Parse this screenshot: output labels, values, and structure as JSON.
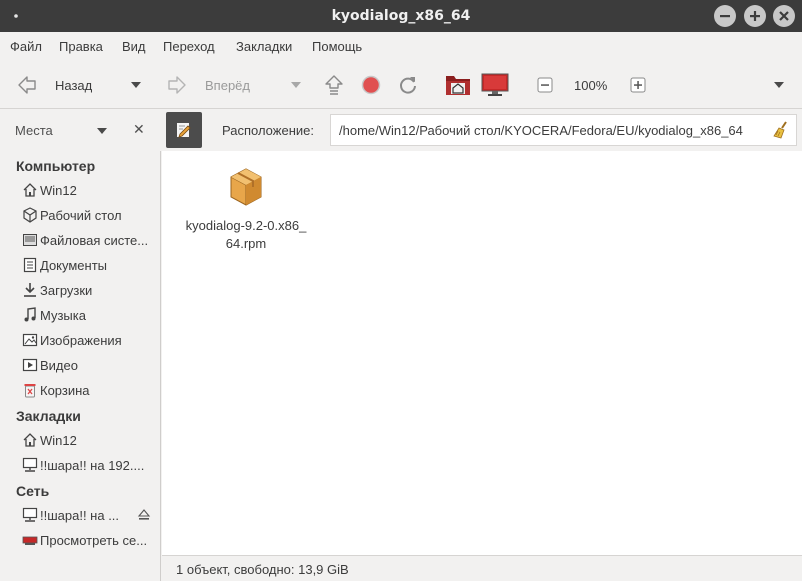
{
  "window": {
    "title": "kyodialog_x86_64"
  },
  "menubar": {
    "items": [
      "Файл",
      "Правка",
      "Вид",
      "Переход",
      "Закладки",
      "Помощь"
    ]
  },
  "toolbar": {
    "back_label": "Назад",
    "forward_label": "Вперёд",
    "zoom_level": "100%"
  },
  "location": {
    "places_label": "Места",
    "label": "Расположение:",
    "path": "/home/Win12/Рабочий стол/KYOCERA/Fedora/EU/kyodialog_x86_64"
  },
  "sidebar": {
    "sections": [
      {
        "title": "Компьютер",
        "items": [
          {
            "label": "Win12",
            "icon": "home-icon"
          },
          {
            "label": "Рабочий стол",
            "icon": "desktop-icon"
          },
          {
            "label": "Файловая систе...",
            "icon": "filesystem-icon"
          },
          {
            "label": "Документы",
            "icon": "documents-icon"
          },
          {
            "label": "Загрузки",
            "icon": "downloads-icon"
          },
          {
            "label": "Музыка",
            "icon": "music-icon"
          },
          {
            "label": "Изображения",
            "icon": "pictures-icon"
          },
          {
            "label": "Видео",
            "icon": "videos-icon"
          },
          {
            "label": "Корзина",
            "icon": "trash-icon"
          }
        ]
      },
      {
        "title": "Закладки",
        "items": [
          {
            "label": "Win12",
            "icon": "home-icon"
          },
          {
            "label": "!!шара!! на 192....",
            "icon": "network-share-icon"
          }
        ]
      },
      {
        "title": "Сеть",
        "items": [
          {
            "label": "!!шара!! на ...",
            "icon": "network-share-icon"
          },
          {
            "label": "Просмотреть се...",
            "icon": "network-browse-icon"
          }
        ]
      }
    ]
  },
  "files": [
    {
      "name_line1": "kyodialog-9.2-0.x86_",
      "name_line2": "64.rpm",
      "icon": "package-icon"
    }
  ],
  "status": {
    "text": "1 объект, свободно: 13,9 GiB"
  },
  "colors": {
    "titlebar": "#3c3c3c",
    "background": "#f2f1f0",
    "content": "#ffffff",
    "stop_red": "#e04c4c"
  }
}
